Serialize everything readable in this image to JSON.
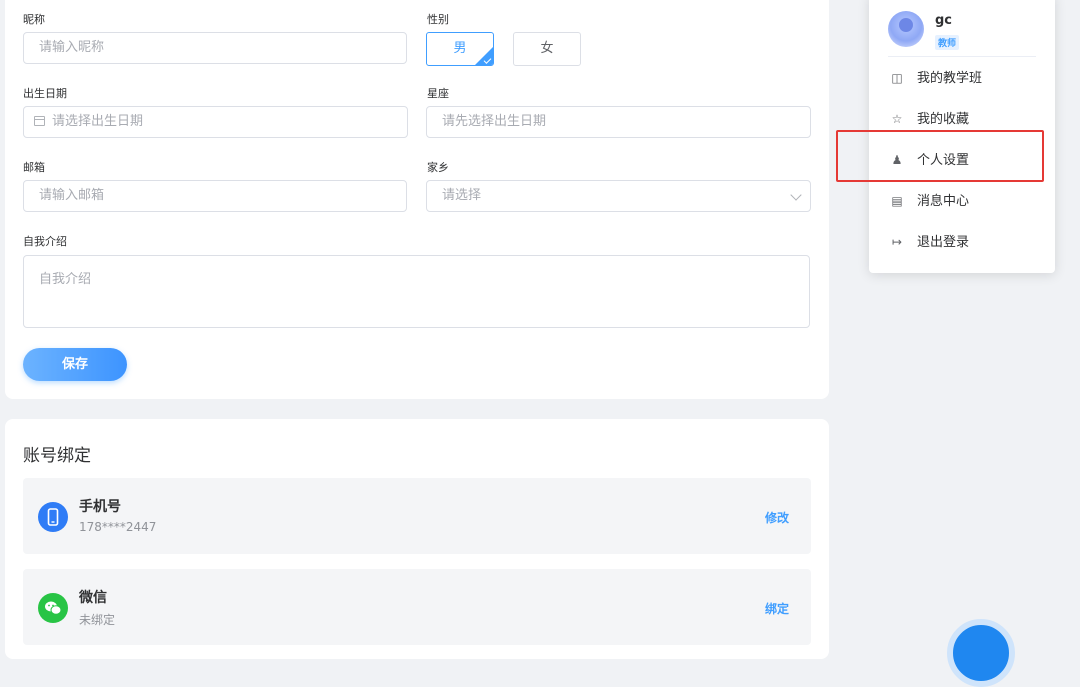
{
  "profile_form": {
    "nickname": {
      "label": "昵称",
      "placeholder": "请输入昵称"
    },
    "gender": {
      "label": "性别",
      "options": [
        "男",
        "女"
      ],
      "selected": "男"
    },
    "birthday": {
      "label": "出生日期",
      "placeholder": "请选择出生日期"
    },
    "constellation": {
      "label": "星座",
      "placeholder": "请先选择出生日期"
    },
    "email": {
      "label": "邮箱",
      "placeholder": "请输入邮箱"
    },
    "hometown": {
      "label": "家乡",
      "placeholder": "请选择"
    },
    "bio": {
      "label": "自我介绍",
      "placeholder": "自我介绍"
    },
    "save_label": "保存"
  },
  "account_binding": {
    "title": "账号绑定",
    "items": [
      {
        "name": "手机号",
        "value": "178****2447",
        "action": "修改",
        "icon": "phone-icon",
        "color": "#2f7cf6"
      },
      {
        "name": "微信",
        "value": "未绑定",
        "action": "绑定",
        "icon": "wechat-icon",
        "color": "#28c445"
      }
    ]
  },
  "user_menu": {
    "username": "gc",
    "role": "教师",
    "items": [
      {
        "label": "我的教学班",
        "icon": "class-icon"
      },
      {
        "label": "我的收藏",
        "icon": "star-icon"
      },
      {
        "label": "个人设置",
        "icon": "user-settings-icon",
        "highlighted": true
      },
      {
        "label": "消息中心",
        "icon": "message-icon"
      },
      {
        "label": "退出登录",
        "icon": "logout-icon"
      }
    ]
  },
  "colors": {
    "primary": "#409eff",
    "highlight_border": "#e53935"
  }
}
